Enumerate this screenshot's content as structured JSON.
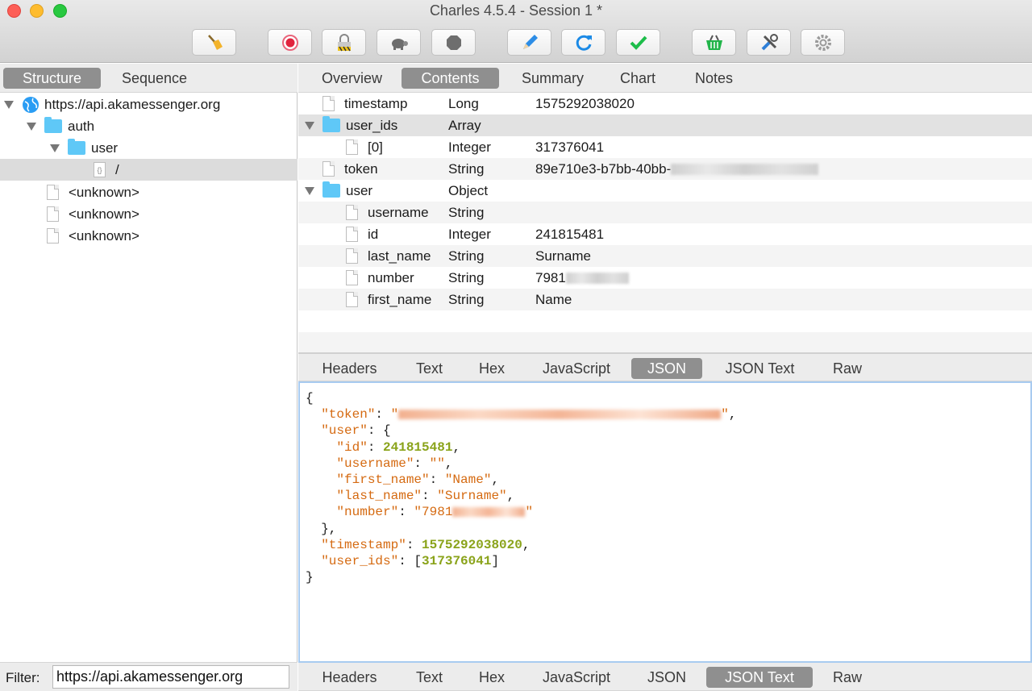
{
  "window": {
    "title": "Charles 4.5.4 - Session 1 *"
  },
  "toolbar": {
    "buttons": [
      {
        "name": "broom-icon",
        "action": "Clear session"
      },
      {
        "name": "record-icon",
        "action": "Record"
      },
      {
        "name": "ssl-lock-icon",
        "action": "SSL proxying"
      },
      {
        "name": "turtle-icon",
        "action": "Throttle"
      },
      {
        "name": "stop-hexagon-icon",
        "action": "Breakpoints"
      },
      {
        "name": "pen-icon",
        "action": "Compose"
      },
      {
        "name": "refresh-icon",
        "action": "Repeat"
      },
      {
        "name": "checkmark-icon",
        "action": "Validate"
      },
      {
        "name": "basket-icon",
        "action": "Tools"
      },
      {
        "name": "tools-icon",
        "action": "Settings"
      },
      {
        "name": "gear-icon",
        "action": "Preferences"
      }
    ]
  },
  "left": {
    "tabs": {
      "structure": "Structure",
      "sequence": "Sequence"
    },
    "tree": {
      "host": "https://api.akamessenger.org",
      "folder1": "auth",
      "folder2": "user",
      "leaf": "/",
      "unknown1": "<unknown>",
      "unknown2": "<unknown>",
      "unknown3": "<unknown>"
    },
    "filter": {
      "label": "Filter:",
      "value": "https://api.akamessenger.org"
    }
  },
  "top_tabs": {
    "overview": "Overview",
    "contents": "Contents",
    "summary": "Summary",
    "chart": "Chart",
    "notes": "Notes"
  },
  "grid": {
    "rows": [
      {
        "name": "timestamp",
        "type": "Long",
        "value": "1575292038020"
      },
      {
        "name": "user_ids",
        "type": "Array",
        "value": ""
      },
      {
        "name": "[0]",
        "type": "Integer",
        "value": "317376041"
      },
      {
        "name": "token",
        "type": "String",
        "value": "89e710e3-b7bb-40bb-"
      },
      {
        "name": "user",
        "type": "Object",
        "value": ""
      },
      {
        "name": "username",
        "type": "String",
        "value": ""
      },
      {
        "name": "id",
        "type": "Integer",
        "value": "241815481"
      },
      {
        "name": "last_name",
        "type": "String",
        "value": "Surname"
      },
      {
        "name": "number",
        "type": "String",
        "value": "7981"
      },
      {
        "name": "first_name",
        "type": "String",
        "value": "Name"
      }
    ]
  },
  "viewer_tabs": {
    "headers": "Headers",
    "text": "Text",
    "hex": "Hex",
    "javascript": "JavaScript",
    "json": "JSON",
    "json_text": "JSON Text",
    "raw": "Raw"
  },
  "json_view": {
    "open_brace": "{",
    "close_brace": "}",
    "token_key": "\"token\"",
    "user_key": "\"user\"",
    "id_key": "\"id\"",
    "id_val": "241815481",
    "username_key": "\"username\"",
    "username_val": "\"\"",
    "first_name_key": "\"first_name\"",
    "first_name_val": "\"Name\"",
    "last_name_key": "\"last_name\"",
    "last_name_val": "\"Surname\"",
    "number_key": "\"number\"",
    "number_val_prefix": "\"7981",
    "timestamp_key": "\"timestamp\"",
    "timestamp_val": "1575292038020",
    "user_ids_key": "\"user_ids\"",
    "user_ids_val": "317376041"
  }
}
